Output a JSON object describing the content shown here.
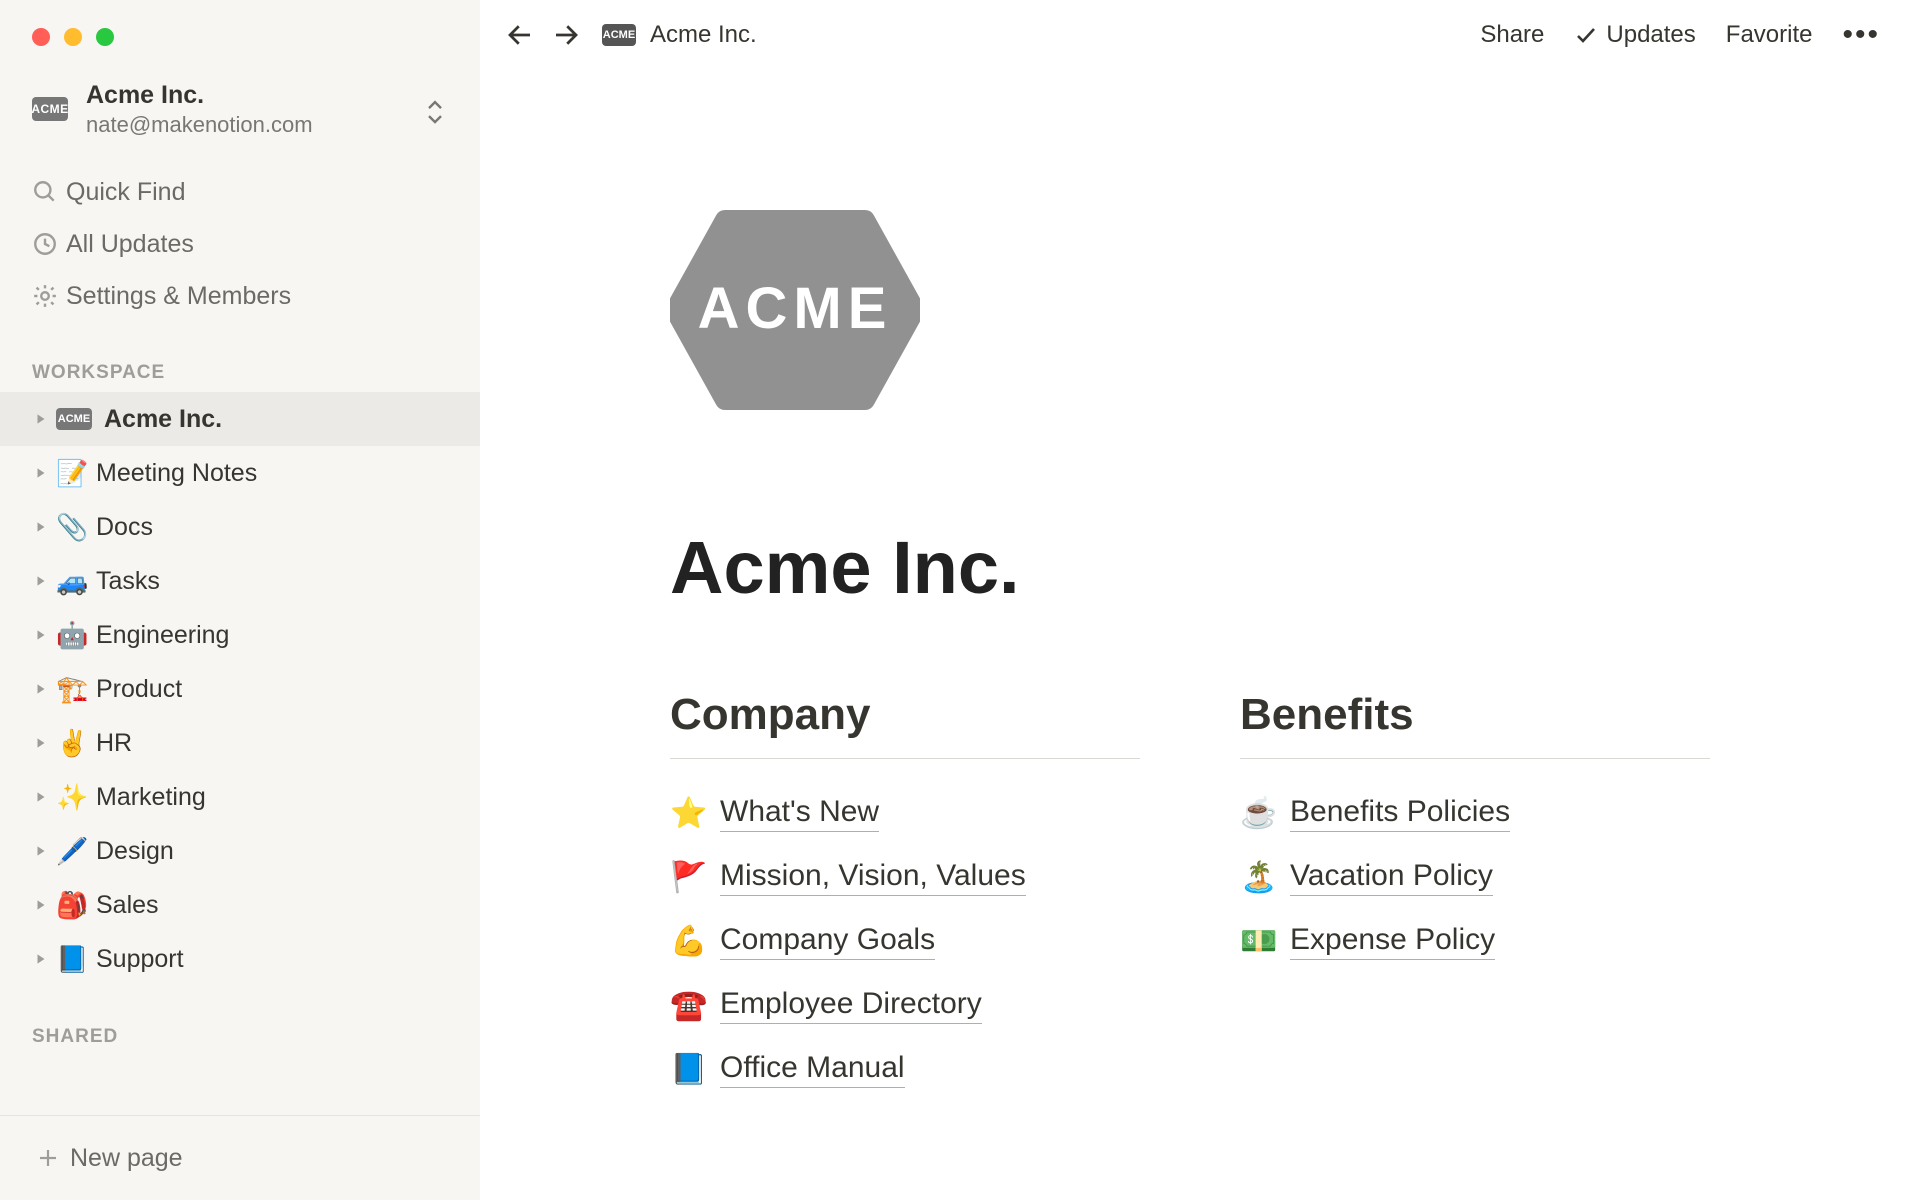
{
  "sidebar": {
    "workspace": {
      "name": "Acme Inc.",
      "email": "nate@makenotion.com",
      "chip": "ACME"
    },
    "nav": {
      "quick_find": "Quick Find",
      "all_updates": "All Updates",
      "settings": "Settings & Members"
    },
    "workspace_header": "WORKSPACE",
    "pages": [
      {
        "label": "Acme Inc.",
        "chip": "ACME",
        "selected": true
      },
      {
        "label": "Meeting Notes",
        "emoji": "📝"
      },
      {
        "label": "Docs",
        "emoji": "📎"
      },
      {
        "label": "Tasks",
        "emoji": "🚙"
      },
      {
        "label": "Engineering",
        "emoji": "🤖"
      },
      {
        "label": "Product",
        "emoji": "🏗️"
      },
      {
        "label": "HR",
        "emoji": "✌️"
      },
      {
        "label": "Marketing",
        "emoji": "✨"
      },
      {
        "label": "Design",
        "emoji": "🖊️"
      },
      {
        "label": "Sales",
        "emoji": "🎒"
      },
      {
        "label": "Support",
        "emoji": "📘"
      }
    ],
    "shared_header": "SHARED",
    "new_page": "New page"
  },
  "topbar": {
    "breadcrumb": {
      "chip": "ACME",
      "label": "Acme Inc."
    },
    "share": "Share",
    "updates": "Updates",
    "favorite": "Favorite"
  },
  "page": {
    "logo_text": "ACME",
    "title": "Acme Inc.",
    "columns": [
      {
        "header": "Company",
        "links": [
          {
            "emoji": "⭐",
            "label": "What's New"
          },
          {
            "emoji": "🚩",
            "label": "Mission, Vision, Values"
          },
          {
            "emoji": "💪",
            "label": "Company Goals"
          },
          {
            "emoji": "☎️",
            "label": "Employee Directory"
          },
          {
            "emoji": "📘",
            "label": "Office Manual"
          }
        ]
      },
      {
        "header": "Benefits",
        "links": [
          {
            "emoji": "☕",
            "label": "Benefits Policies"
          },
          {
            "emoji": "🏝️",
            "label": "Vacation Policy"
          },
          {
            "emoji": "💵",
            "label": "Expense Policy"
          }
        ]
      }
    ]
  }
}
